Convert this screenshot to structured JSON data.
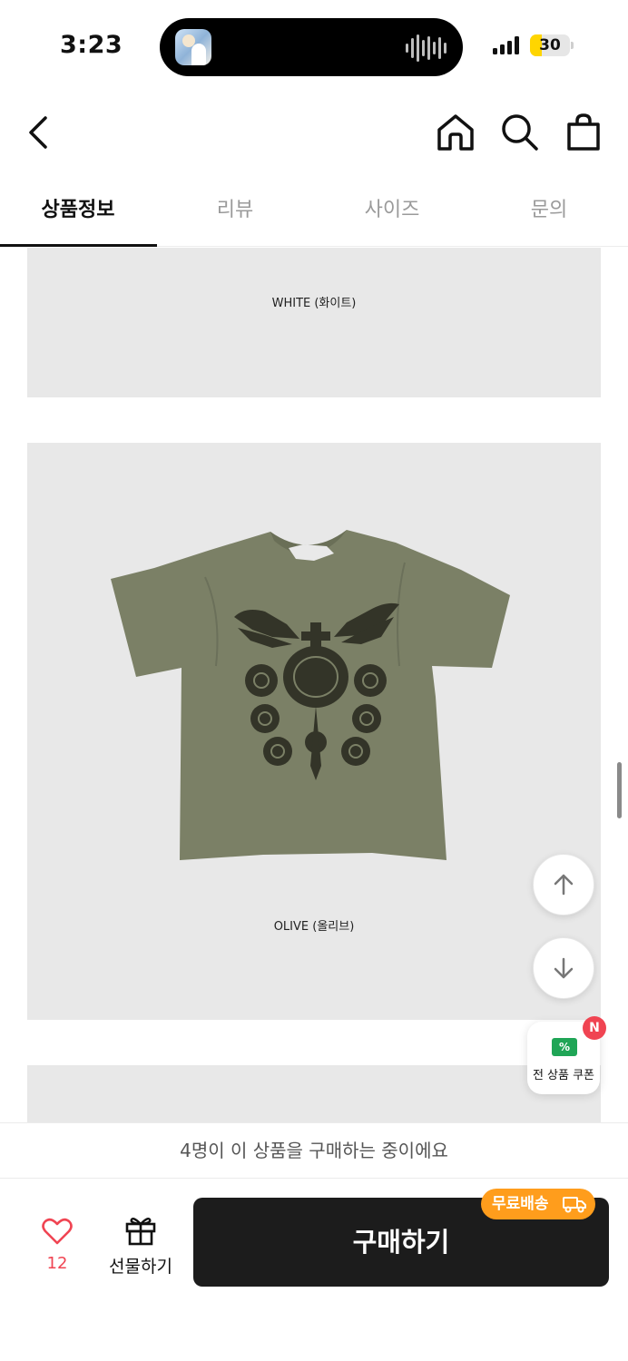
{
  "status_bar": {
    "time": "3:23",
    "battery": "30",
    "battery_level": 0.3
  },
  "header": {
    "back_icon": "chevron-left-icon",
    "icons": [
      "home-icon",
      "search-icon",
      "shopping-bag-icon"
    ]
  },
  "tabs": [
    {
      "label": "상품정보",
      "active": true
    },
    {
      "label": "리뷰",
      "active": false
    },
    {
      "label": "사이즈",
      "active": false
    },
    {
      "label": "문의",
      "active": false
    }
  ],
  "content": {
    "panels": [
      {
        "caption": "WHITE (화이트)"
      },
      {
        "caption": "OLIVE (올리브)",
        "image": "olive-tshirt-photo"
      }
    ]
  },
  "floating": {
    "scroll_up_icon": "arrow-up-icon",
    "scroll_down_icon": "arrow-down-icon",
    "coupon": {
      "label": "전 상품 쿠폰",
      "icon_text": "%",
      "badge": "N"
    }
  },
  "notice": {
    "text": "4명이 이 상품을 구매하는 중이에요"
  },
  "bottom_bar": {
    "like_count": "12",
    "gift_label": "선물하기",
    "buy_label": "구매하기",
    "free_shipping_label": "무료배송"
  },
  "colors": {
    "accent_red": "#f04452",
    "shipping_orange": "#ff9d1c",
    "buy_black": "#1c1c1c",
    "coupon_green": "#1fa556"
  }
}
